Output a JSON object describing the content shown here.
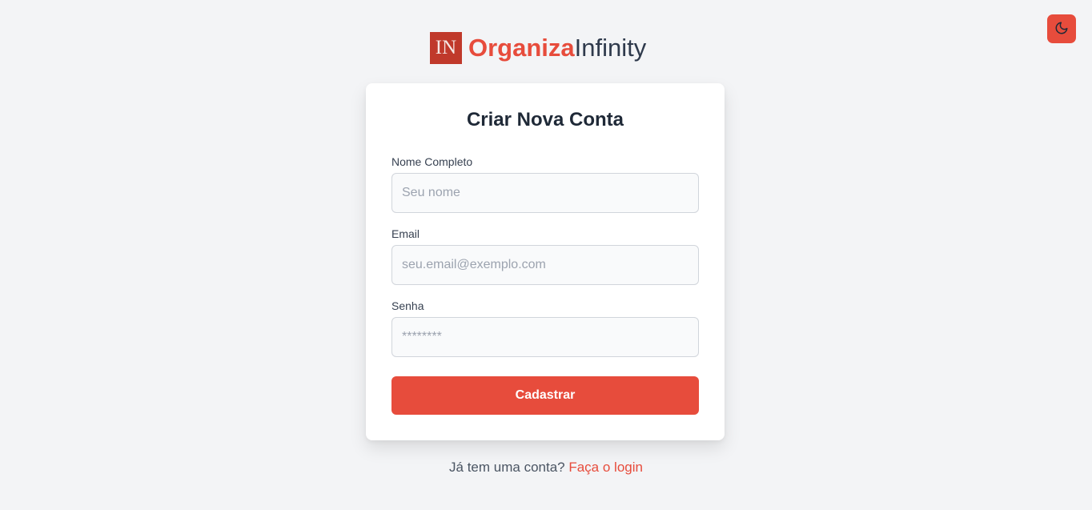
{
  "theme_toggle": {
    "icon": "moon-icon"
  },
  "brand": {
    "mark": "IN",
    "name_part1": "Organiza",
    "name_part2": "Infinity"
  },
  "form": {
    "title": "Criar Nova Conta",
    "fields": [
      {
        "label": "Nome Completo",
        "placeholder": "Seu nome",
        "value": ""
      },
      {
        "label": "Email",
        "placeholder": "seu.email@exemplo.com",
        "value": ""
      },
      {
        "label": "Senha",
        "placeholder": "********",
        "value": ""
      }
    ],
    "submit_label": "Cadastrar"
  },
  "footer": {
    "text": "Já tem uma conta?",
    "link_label": "Faça o login"
  },
  "colors": {
    "accent": "#e74c3c",
    "logo_bg": "#c0392b",
    "background": "#f3f4f6",
    "card": "#ffffff"
  }
}
